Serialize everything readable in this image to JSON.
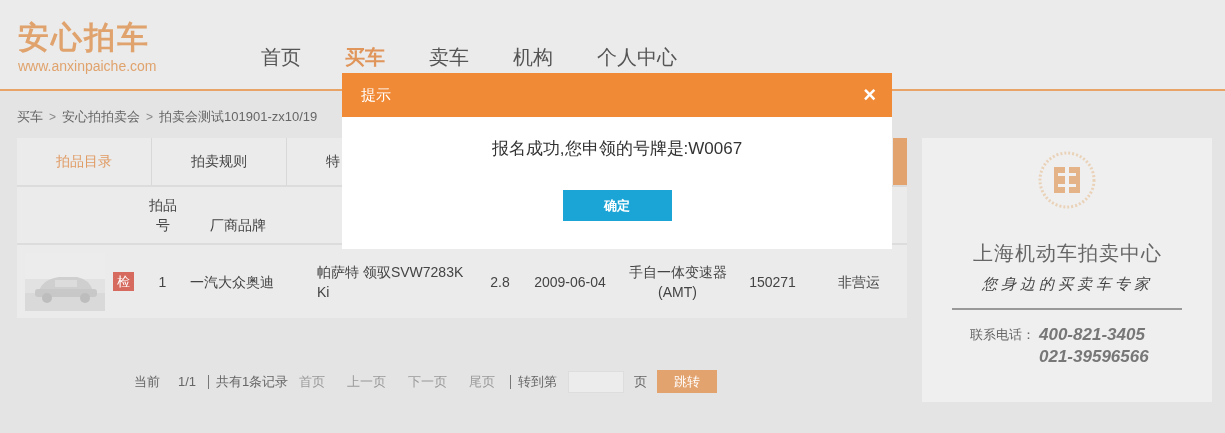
{
  "logo": {
    "title": "安心拍车",
    "url": "www.anxinpaiche.com"
  },
  "nav": [
    {
      "label": "首页",
      "selected": false
    },
    {
      "label": "买车",
      "selected": true
    },
    {
      "label": "卖车",
      "selected": false
    },
    {
      "label": "机构",
      "selected": false
    },
    {
      "label": "个人中心",
      "selected": false
    }
  ],
  "breadcrumb": [
    {
      "kind": "link",
      "label": "买车"
    },
    {
      "kind": "separator",
      "label": ">"
    },
    {
      "kind": "link",
      "label": "安心拍拍卖会"
    },
    {
      "kind": "separator",
      "label": ">"
    },
    {
      "kind": "link",
      "label": "拍卖会测试101901-zx10/19"
    }
  ],
  "tabs": [
    {
      "label": "拍品目录",
      "selected": true
    },
    {
      "label": "拍卖规则",
      "selected": false
    },
    {
      "label": "特",
      "selected": false
    }
  ],
  "table": {
    "columns": [
      {
        "label": "拍品号"
      },
      {
        "label": "厂商品牌"
      }
    ],
    "rows": [
      {
        "badge": "检",
        "cells": [
          "1",
          "一汽大众奥迪",
          "帕萨特 领驭SVW7283KKi",
          "2.8",
          "2009-06-04",
          "手自一体变速器(AMT)",
          "150271",
          "非营运"
        ]
      }
    ]
  },
  "pager": {
    "current_label": "当前",
    "current": "1/1",
    "total": "共有1条记录",
    "links": [
      {
        "label": "首页",
        "disabled": true
      },
      {
        "label": "上一页",
        "disabled": true
      },
      {
        "label": "下一页",
        "disabled": true
      },
      {
        "label": "尾页",
        "disabled": true
      }
    ],
    "goto_label": "转到第",
    "page_unit": "页",
    "go_button": "跳转"
  },
  "ad": {
    "title": "上海机动车拍卖中心",
    "slogan": "您身边的买卖车专家",
    "contact_label": "联系电话：",
    "phones": [
      "400-821-3405",
      "021-39596566"
    ]
  },
  "dialog": {
    "title": "提示",
    "close": "×",
    "message": "报名成功,您申领的号牌是:W0067",
    "ok_button": "确定"
  }
}
